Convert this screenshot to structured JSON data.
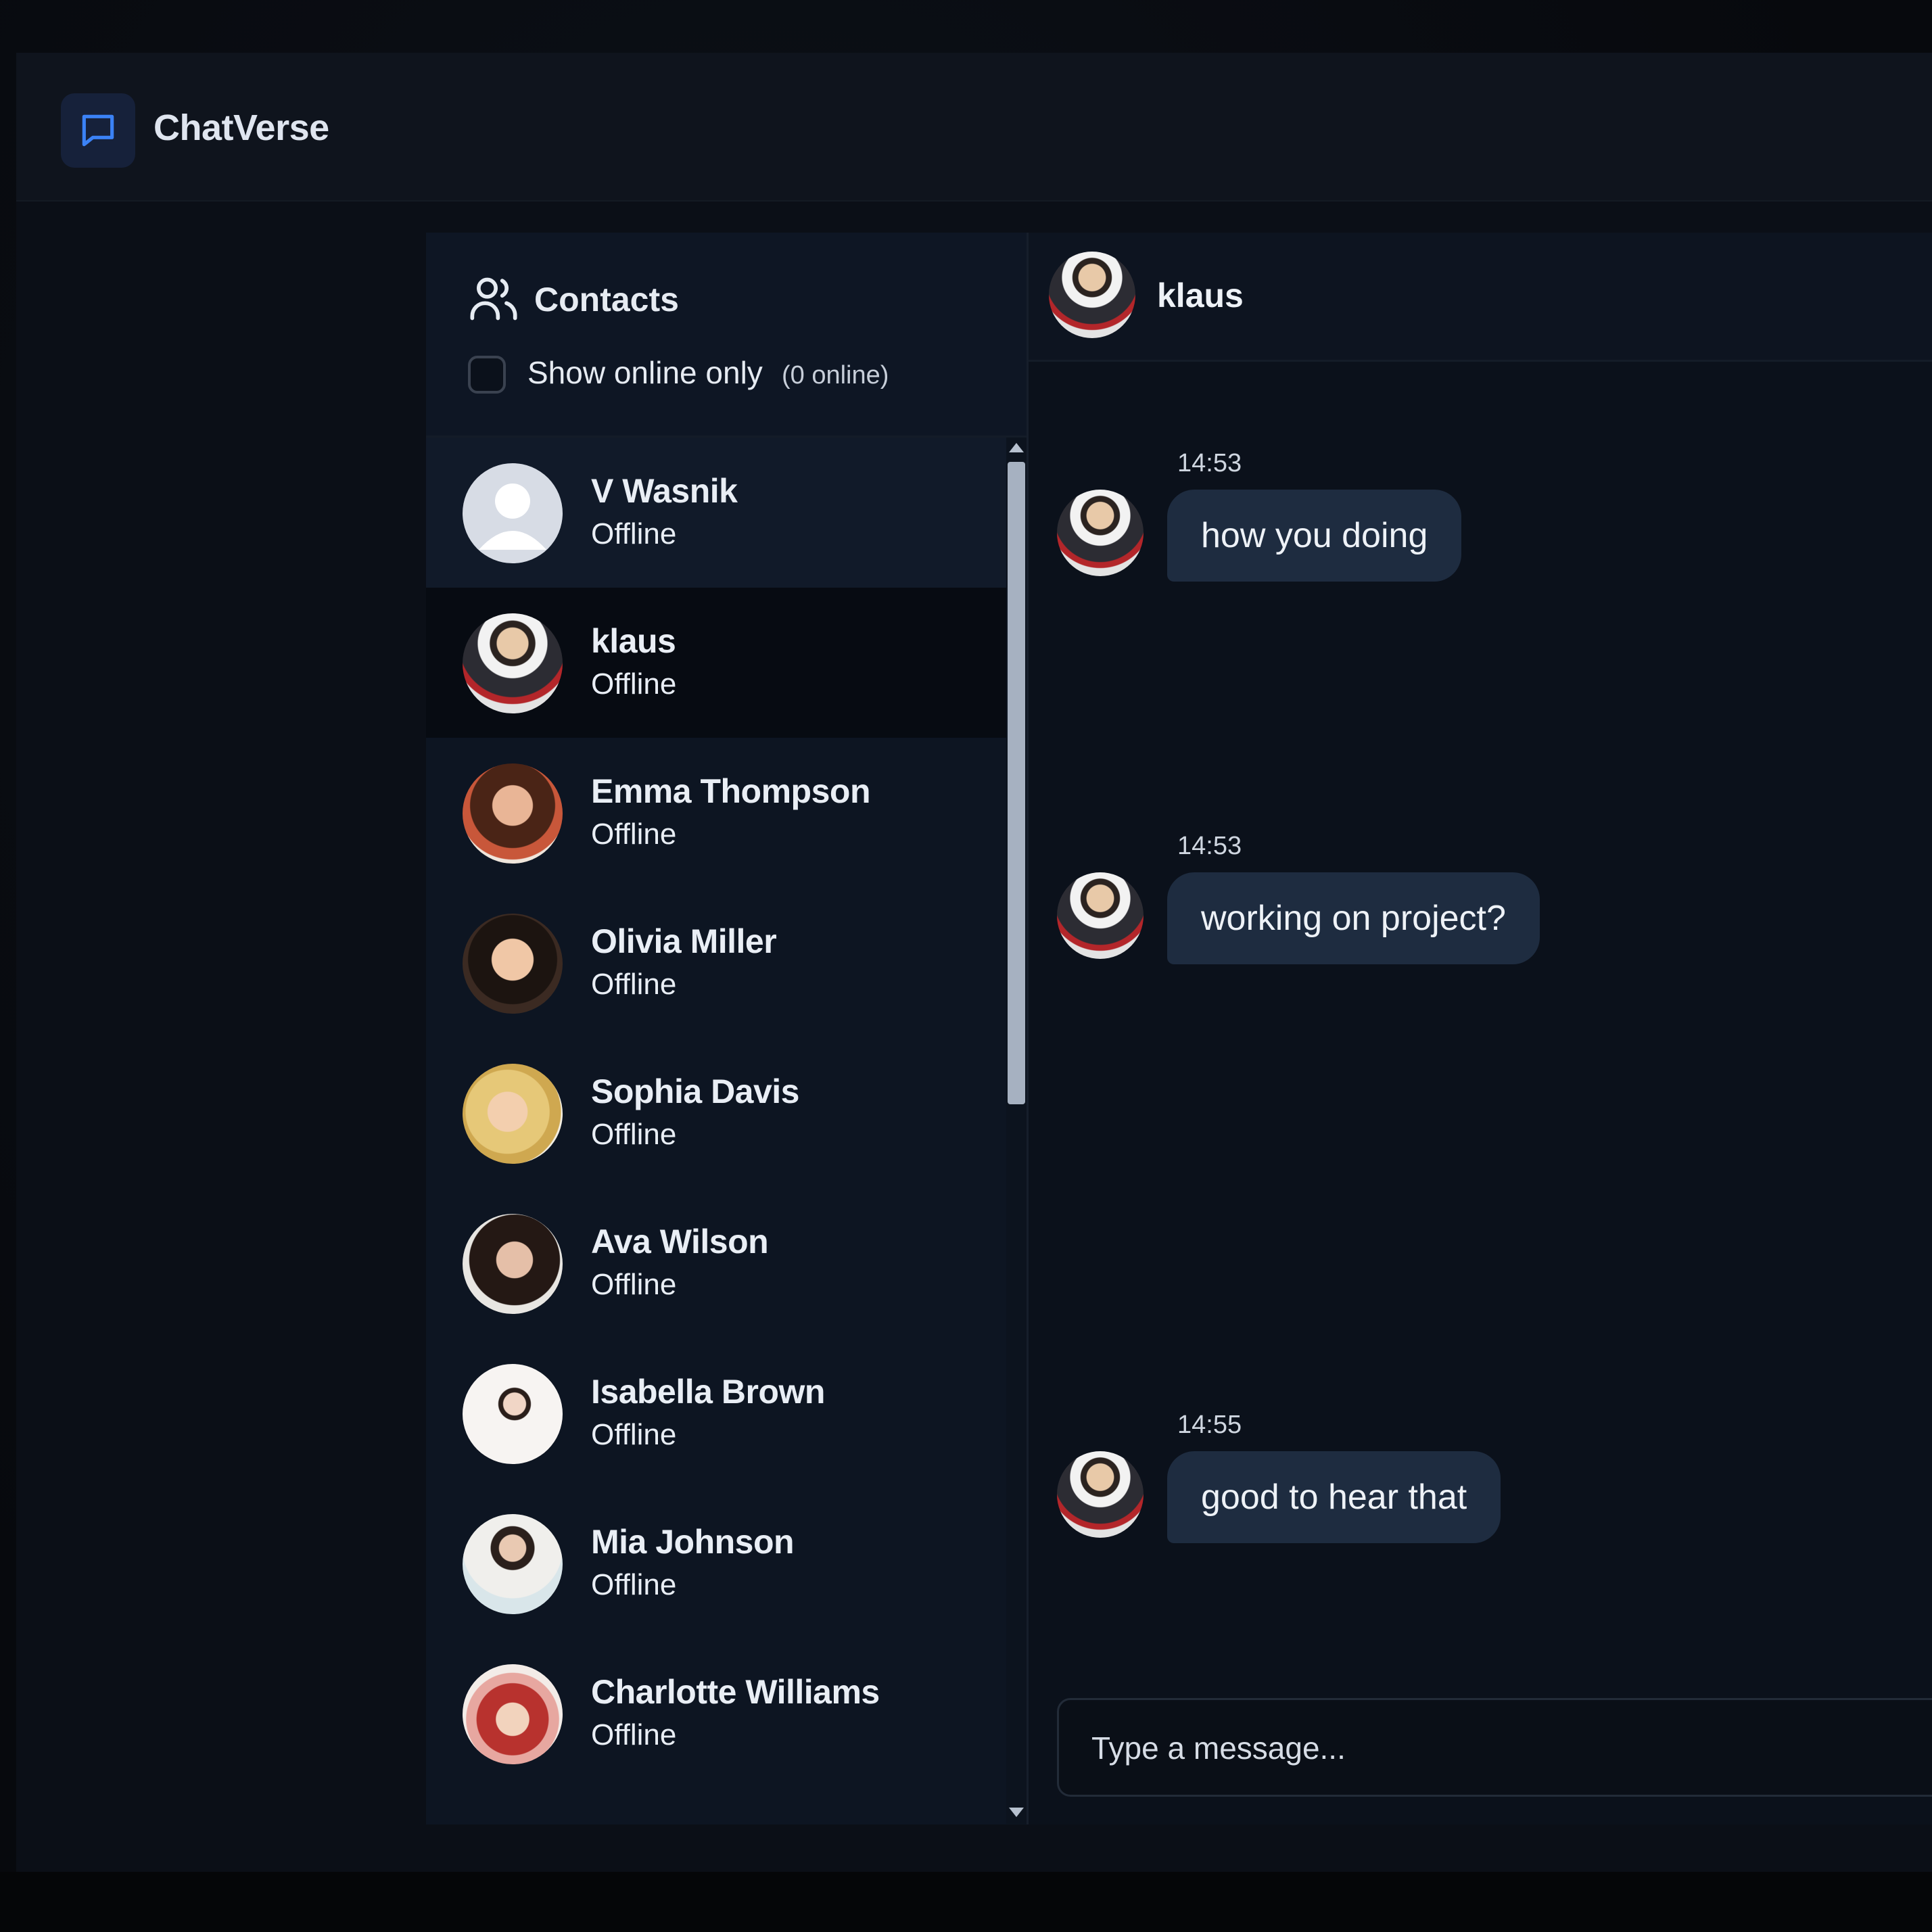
{
  "app": {
    "title": "ChatVerse",
    "logo_icon": "chat-bubble-icon",
    "accent_color": "#3b82f6"
  },
  "contacts": {
    "title": "Contacts",
    "icon": "users-icon",
    "filter": {
      "label": "Show online only",
      "count_text": "(0 online)",
      "checked": false
    },
    "items": [
      {
        "name": "V Wasnik",
        "status": "Offline",
        "avatar": "default-avatar"
      },
      {
        "name": "klaus",
        "status": "Offline",
        "avatar": "photo-avatar"
      },
      {
        "name": "Emma Thompson",
        "status": "Offline",
        "avatar": "photo-avatar"
      },
      {
        "name": "Olivia Miller",
        "status": "Offline",
        "avatar": "photo-avatar"
      },
      {
        "name": "Sophia Davis",
        "status": "Offline",
        "avatar": "photo-avatar"
      },
      {
        "name": "Ava Wilson",
        "status": "Offline",
        "avatar": "photo-avatar"
      },
      {
        "name": "Isabella Brown",
        "status": "Offline",
        "avatar": "photo-avatar"
      },
      {
        "name": "Mia Johnson",
        "status": "Offline",
        "avatar": "photo-avatar"
      },
      {
        "name": "Charlotte Williams",
        "status": "Offline",
        "avatar": "photo-avatar"
      }
    ]
  },
  "chat": {
    "contact_name": "klaus",
    "messages": [
      {
        "time": "14:53",
        "text": "how you doing"
      },
      {
        "time": "14:53",
        "text": "working on project?"
      },
      {
        "time": "14:55",
        "text": "good to hear that"
      }
    ],
    "input": {
      "placeholder": "Type a message..."
    }
  }
}
